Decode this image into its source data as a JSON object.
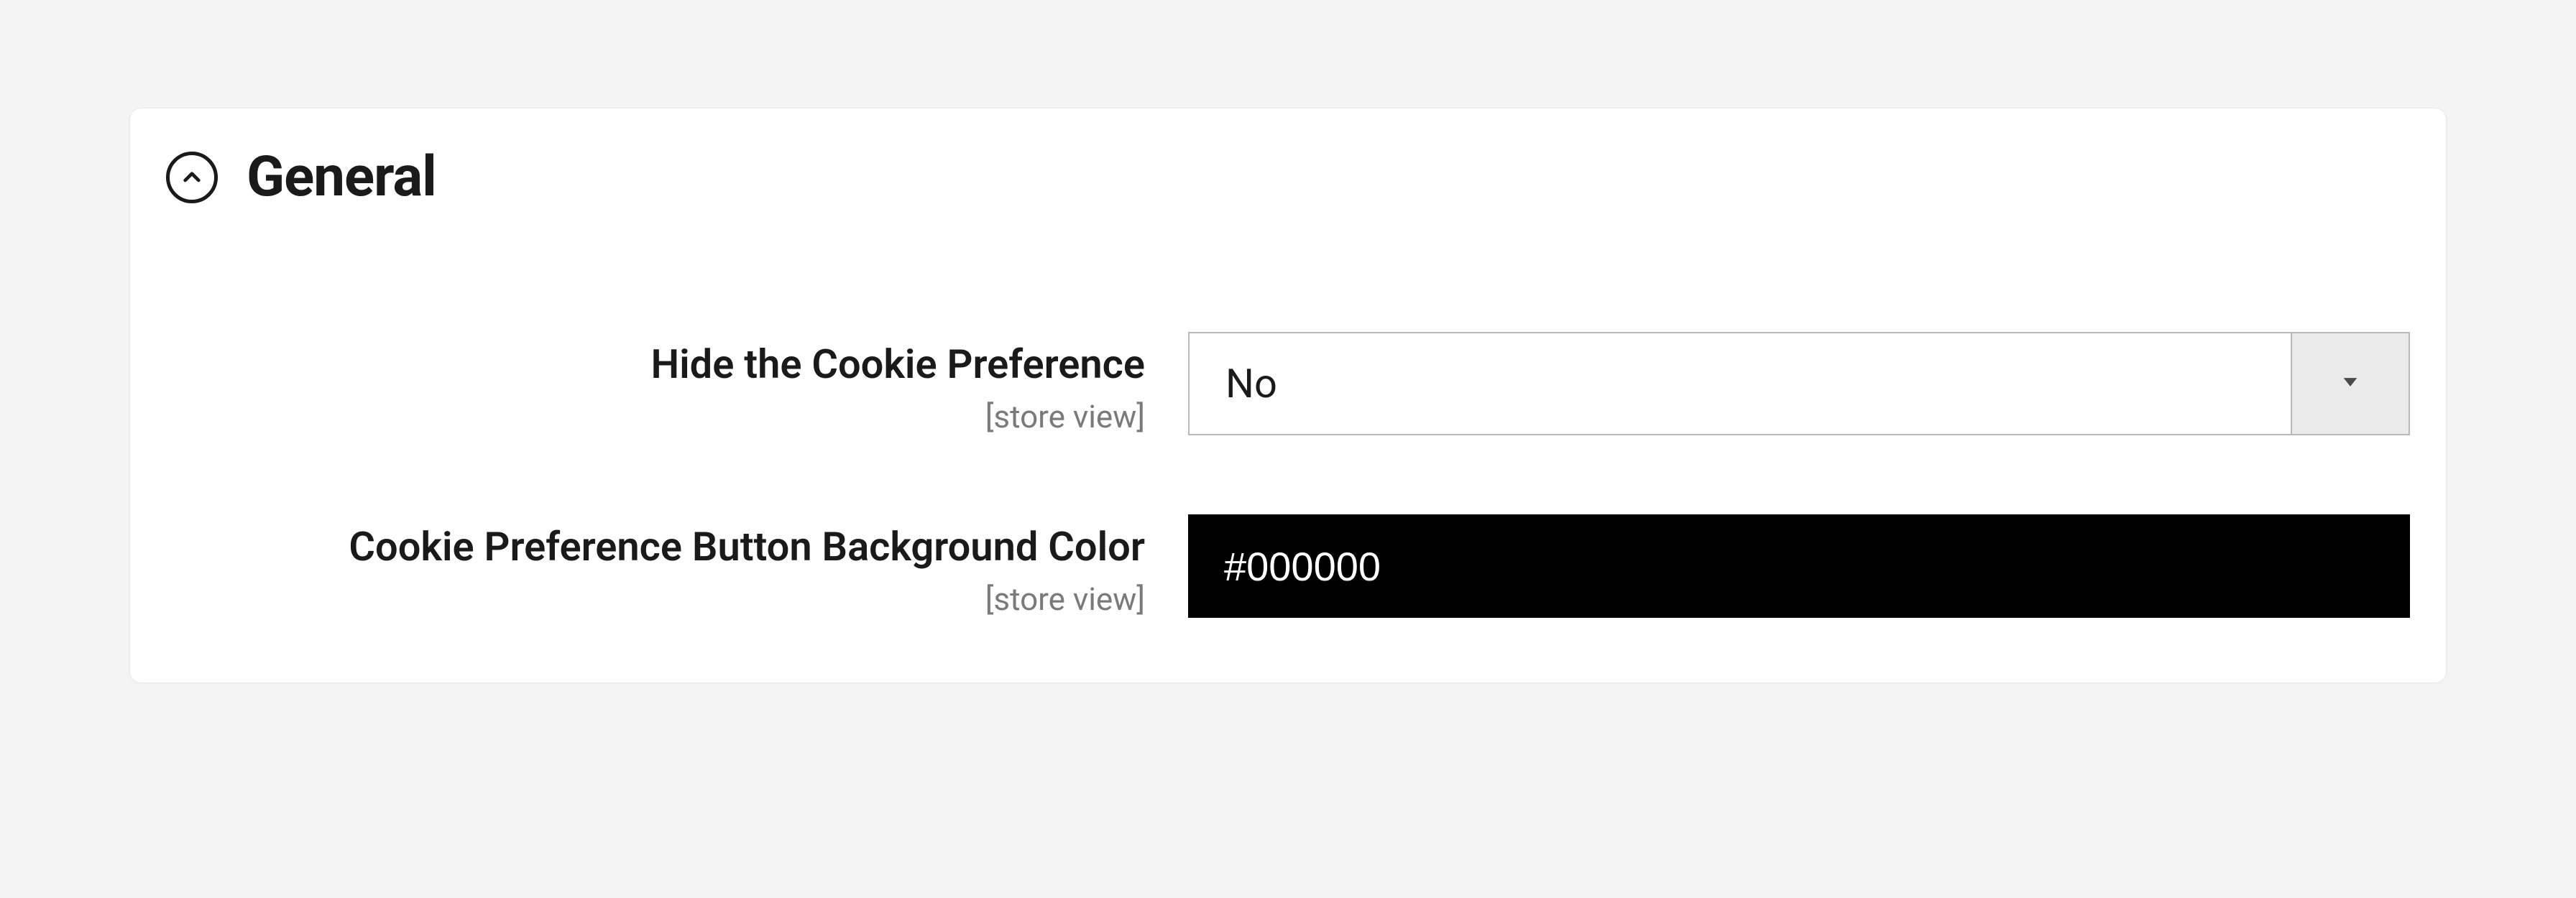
{
  "section": {
    "title": "General"
  },
  "fields": {
    "hide_cookie_pref": {
      "label": "Hide the Cookie Preference",
      "scope": "[store view]",
      "value": "No"
    },
    "button_bg_color": {
      "label": "Cookie Preference Button Background Color",
      "scope": "[store view]",
      "value": "#000000"
    }
  }
}
